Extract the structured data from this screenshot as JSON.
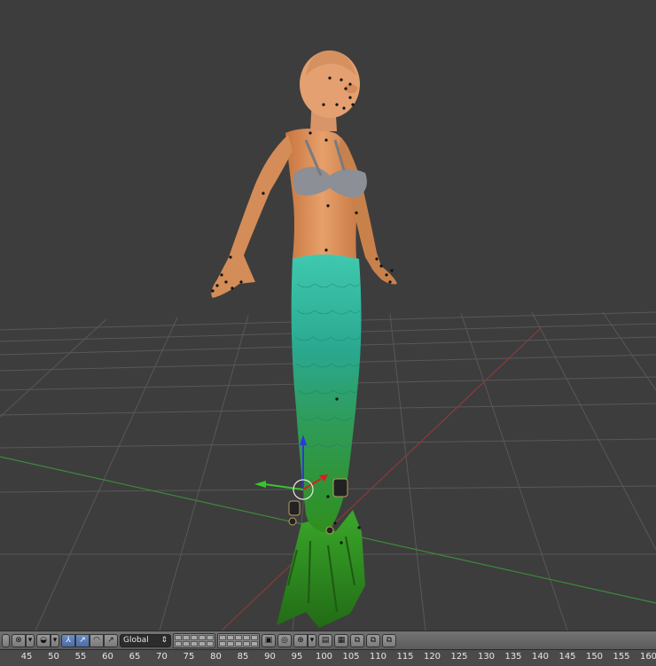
{
  "header": {
    "orientation_select": "Global",
    "icons": [
      "object-mode-icon",
      "pivot-icon",
      "snap-icon",
      "manipulator-icon",
      "translate-icon",
      "rotate-icon",
      "scale-icon",
      "layers-icon",
      "lock-icon",
      "proportional-edit-icon",
      "render-icon",
      "camera-icon"
    ]
  },
  "timeline": {
    "ticks": [
      "45",
      "50",
      "55",
      "60",
      "65",
      "70",
      "75",
      "80",
      "85",
      "90",
      "95",
      "100",
      "105",
      "110",
      "115",
      "120",
      "125",
      "130",
      "135",
      "140",
      "145",
      "150",
      "155",
      "160"
    ]
  },
  "colors": {
    "viewport_bg": "#3d3d3d",
    "grid": "#555555",
    "x_axis": "#9a3a3a",
    "y_axis": "#3f8c3f",
    "tail": "#2fb58a"
  }
}
